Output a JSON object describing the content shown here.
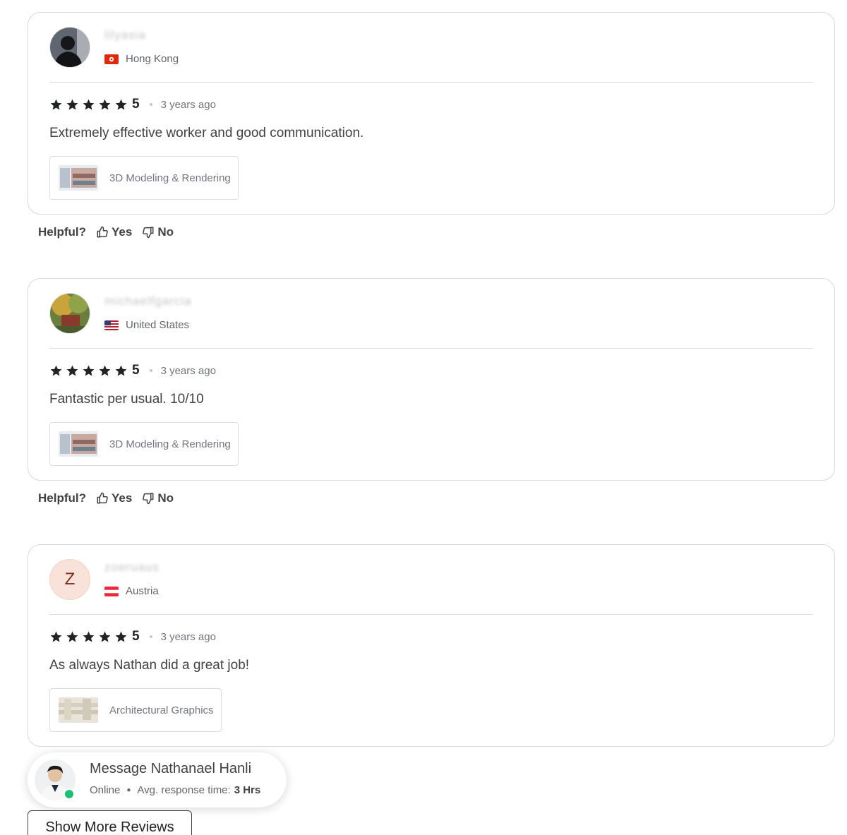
{
  "colors": {
    "star": "#222325",
    "online": "#1dbf73",
    "avatar_letter_bg": "#f9e2d9"
  },
  "reviews": [
    {
      "username": "lilyasia",
      "avatar": "photo",
      "country": "Hong Kong",
      "flag": "hk",
      "rating": "5",
      "time": "3 years ago",
      "text": "Extremely effective worker and good communication.",
      "service": "3D Modeling & Rendering",
      "helpful": {
        "label": "Helpful?",
        "yes": "Yes",
        "no": "No"
      }
    },
    {
      "username": "michaelfgarcia",
      "avatar": "photo",
      "country": "United States",
      "flag": "us",
      "rating": "5",
      "time": "3 years ago",
      "text": "Fantastic per usual. 10/10",
      "service": "3D Modeling & Rendering",
      "helpful": {
        "label": "Helpful?",
        "yes": "Yes",
        "no": "No"
      }
    },
    {
      "username": "zoeruaus",
      "avatar": "letter",
      "avatar_letter": "Z",
      "country": "Austria",
      "flag": "at",
      "rating": "5",
      "time": "3 years ago",
      "text": "As always Nathan did a great job!",
      "service": "Architectural Graphics"
    }
  ],
  "messenger": {
    "title": "Message Nathanael Hanli",
    "status": "Online",
    "response_label": "Avg. response time:",
    "response_value": "3 Hrs"
  },
  "show_more_label": "Show More Reviews"
}
